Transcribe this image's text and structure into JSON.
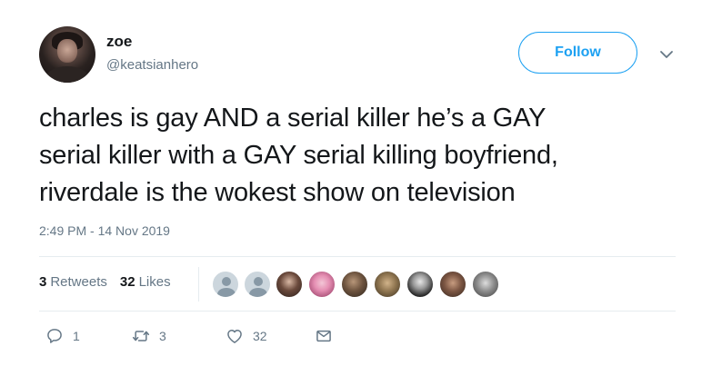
{
  "tweet": {
    "display_name": "zoe",
    "handle": "@keatsianhero",
    "follow_label": "Follow",
    "text": "charles is gay AND a serial killer he’s a GAY\nserial killer with a GAY serial killing boyfriend,\nriverdale is the wokest show on television",
    "timestamp": "2:49 PM - 14 Nov 2019"
  },
  "stats": {
    "retweets_count": "3",
    "retweets_label": "Retweets",
    "likes_count": "32",
    "likes_label": "Likes"
  },
  "actions": {
    "reply_count": "1",
    "retweet_count": "3",
    "like_count": "32"
  },
  "colors": {
    "accent": "#1da1f2",
    "text": "#14171a",
    "muted": "#657786",
    "divider": "#e6ecf0"
  }
}
